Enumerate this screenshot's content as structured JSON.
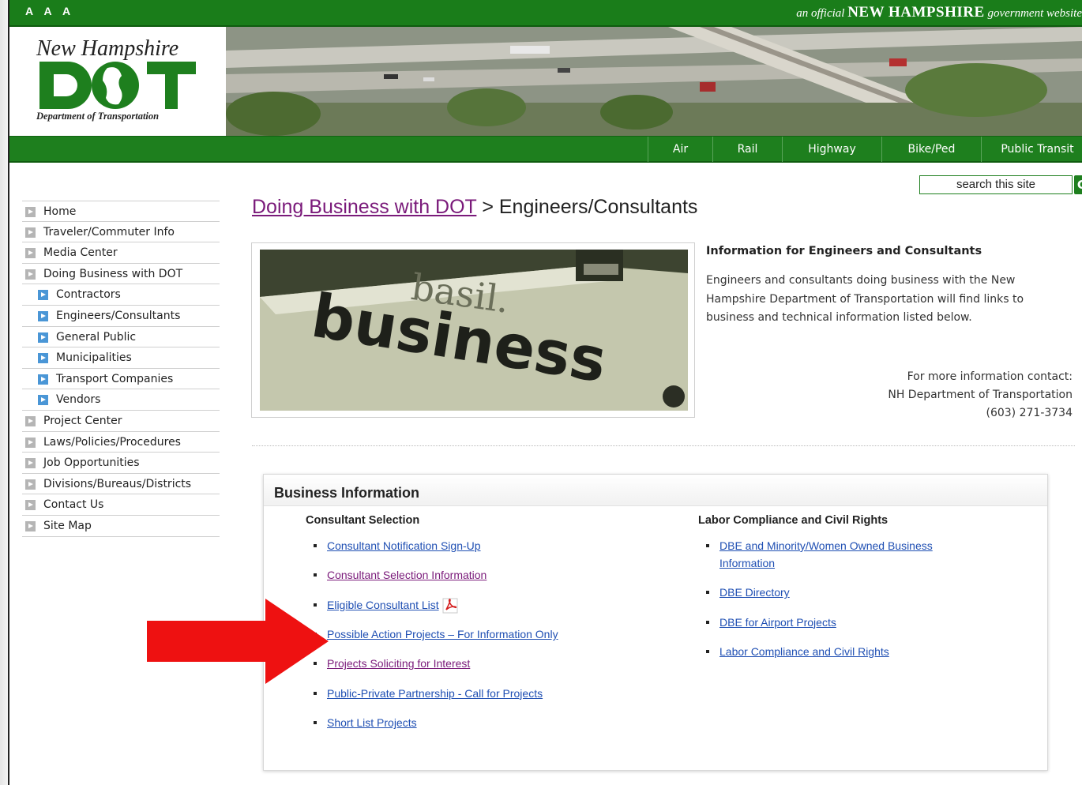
{
  "topbar": {
    "text_size": [
      "A",
      "A",
      "A"
    ],
    "official_prefix": "an official",
    "official_state": "NEW HAMPSHIRE",
    "official_suffix": "government website"
  },
  "logo": {
    "script": "New Hampshire",
    "subtitle": "Department of Transportation"
  },
  "nav": {
    "items": [
      "Air",
      "Rail",
      "Highway",
      "Bike/Ped",
      "Public Transit"
    ]
  },
  "search": {
    "placeholder": "search this site",
    "go_label": "G"
  },
  "leftnav": {
    "items": [
      {
        "label": "Home",
        "sub": false
      },
      {
        "label": "Traveler/Commuter Info",
        "sub": false
      },
      {
        "label": "Media Center",
        "sub": false
      },
      {
        "label": "Doing Business with DOT",
        "sub": false
      },
      {
        "label": "Contractors",
        "sub": true
      },
      {
        "label": "Engineers/Consultants",
        "sub": true
      },
      {
        "label": "General Public",
        "sub": true
      },
      {
        "label": "Municipalities",
        "sub": true
      },
      {
        "label": "Transport Companies",
        "sub": true
      },
      {
        "label": "Vendors",
        "sub": true
      },
      {
        "label": "Project Center",
        "sub": false
      },
      {
        "label": "Laws/Policies/Procedures",
        "sub": false
      },
      {
        "label": "Job Opportunities",
        "sub": false
      },
      {
        "label": "Divisions/Bureaus/Districts",
        "sub": false
      },
      {
        "label": "Contact Us",
        "sub": false
      },
      {
        "label": "Site Map",
        "sub": false
      }
    ]
  },
  "breadcrumb": {
    "parent": "Doing Business with DOT",
    "separator": " > ",
    "current": "Engineers/Consultants"
  },
  "feature": {
    "image_text": "business",
    "image_text_top": "basil."
  },
  "info": {
    "title": "Information for Engineers and Consultants",
    "body": "Engineers and consultants doing business with the New Hampshire Department of Transportation will find links to business and technical information listed below.",
    "contact_line1": "For more information contact:",
    "contact_line2": "NH Department of Transportation",
    "contact_line3": "(603) 271-3734"
  },
  "business": {
    "title": "Business Information",
    "left_heading": "Consultant Selection",
    "left_links": [
      {
        "label": "Consultant Notification Sign-Up",
        "visited": false,
        "pdf": false
      },
      {
        "label": "Consultant Selection Information",
        "visited": true,
        "pdf": false
      },
      {
        "label": "Eligible Consultant List",
        "visited": false,
        "pdf": true
      },
      {
        "label": "Possible Action Projects – For Information Only",
        "visited": false,
        "pdf": false
      },
      {
        "label": "Projects Soliciting for Interest",
        "visited": true,
        "pdf": false
      },
      {
        "label": "Public-Private Partnership - Call for Projects",
        "visited": false,
        "pdf": false
      },
      {
        "label": "Short List Projects",
        "visited": false,
        "pdf": false
      }
    ],
    "right_heading": "Labor Compliance and Civil Rights",
    "right_links": [
      {
        "label": "DBE and Minority/Women Owned Business Information",
        "visited": false
      },
      {
        "label": "DBE Directory",
        "visited": false
      },
      {
        "label": "DBE for Airport Projects",
        "visited": false
      },
      {
        "label": "Labor Compliance and Civil Rights",
        "visited": false
      }
    ]
  },
  "colors": {
    "green": "#1e7f1e",
    "link": "#1f4fb3",
    "visited": "#7a1a7a",
    "arrow": "#ee1111"
  }
}
